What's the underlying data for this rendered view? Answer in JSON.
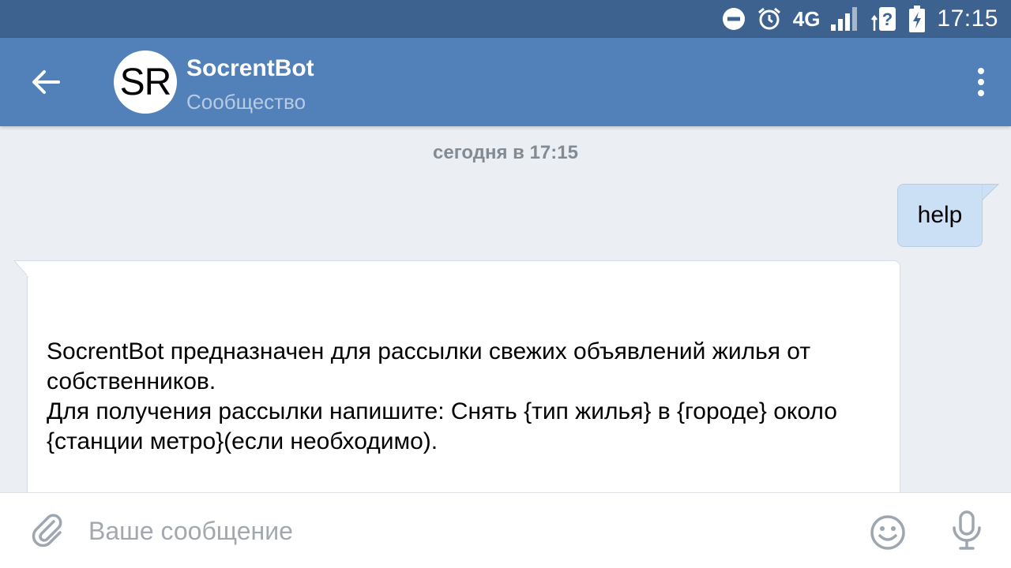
{
  "status_bar": {
    "network": "4G",
    "time": "17:15"
  },
  "header": {
    "avatar_text": "SR",
    "title": "SocrentBot",
    "subtitle": "Сообщество"
  },
  "chat": {
    "date_separator": "сегодня в 17:15",
    "outgoing_message": "help",
    "incoming_message": "SocrentBot предназначен для рассылки свежих объявлений жилья от собственников.\nДля получения рассылки напишите: Снять {тип жилья} в {городе} около {станции метро}(если необходимо).\n\nТипы жилья:\n + комната\n + квартира"
  },
  "input": {
    "placeholder": "Ваше сообщение"
  },
  "colors": {
    "status_bar": "#3d628f",
    "header": "#5181b8",
    "chat_background": "#ebeff3",
    "outgoing_bubble": "#cce0f5",
    "incoming_bubble": "#ffffff",
    "icon_gray": "#9ea6b0"
  },
  "icons": {
    "status": [
      "dnd-icon",
      "alarm-icon",
      "signal-icon",
      "wifi-unknown-icon",
      "battery-charging-icon"
    ],
    "header": [
      "back-arrow-icon",
      "more-vertical-icon"
    ],
    "input": [
      "attach-icon",
      "emoji-icon",
      "microphone-icon"
    ]
  }
}
